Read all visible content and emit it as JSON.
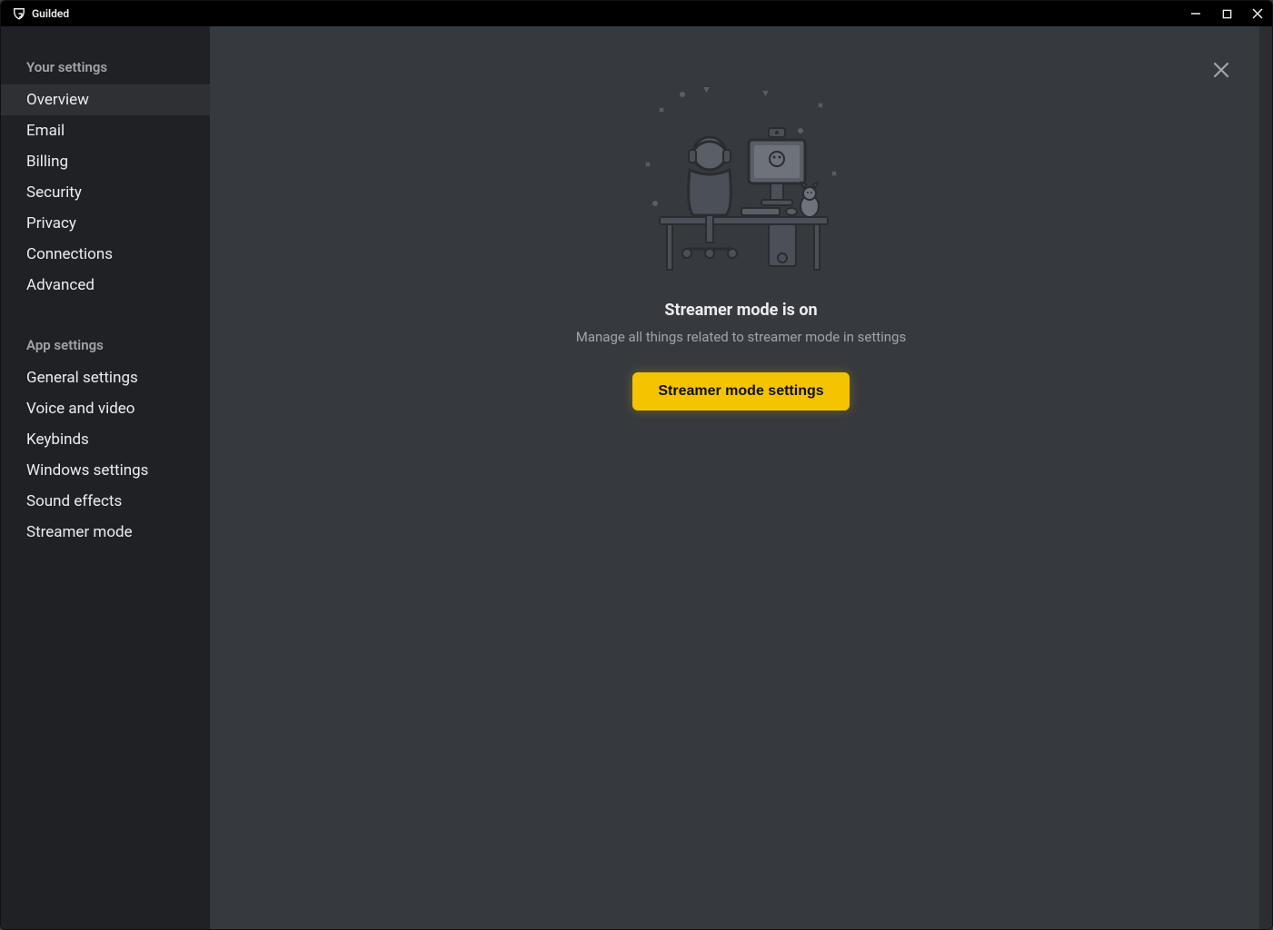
{
  "app": {
    "title": "Guilded"
  },
  "sidebar": {
    "section1": {
      "header": "Your settings",
      "items": [
        {
          "label": "Overview",
          "active": true,
          "key": "overview"
        },
        {
          "label": "Email",
          "active": false,
          "key": "email"
        },
        {
          "label": "Billing",
          "active": false,
          "key": "billing"
        },
        {
          "label": "Security",
          "active": false,
          "key": "security"
        },
        {
          "label": "Privacy",
          "active": false,
          "key": "privacy"
        },
        {
          "label": "Connections",
          "active": false,
          "key": "connections"
        },
        {
          "label": "Advanced",
          "active": false,
          "key": "advanced"
        }
      ]
    },
    "section2": {
      "header": "App settings",
      "items": [
        {
          "label": "General settings",
          "active": false,
          "key": "general-settings"
        },
        {
          "label": "Voice and video",
          "active": false,
          "key": "voice-video"
        },
        {
          "label": "Keybinds",
          "active": false,
          "key": "keybinds"
        },
        {
          "label": "Windows settings",
          "active": false,
          "key": "windows-settings"
        },
        {
          "label": "Sound effects",
          "active": false,
          "key": "sound-effects"
        },
        {
          "label": "Streamer mode",
          "active": false,
          "key": "streamer-mode"
        }
      ]
    }
  },
  "modal": {
    "title": "Streamer mode is on",
    "subtitle": "Manage all things related to streamer mode in settings",
    "button_label": "Streamer mode settings"
  },
  "colors": {
    "accent": "#f5c400",
    "bg_main": "#36393e",
    "bg_sidebar": "#1f2125",
    "text_primary": "#ececee",
    "text_secondary": "#a2a4a8"
  }
}
